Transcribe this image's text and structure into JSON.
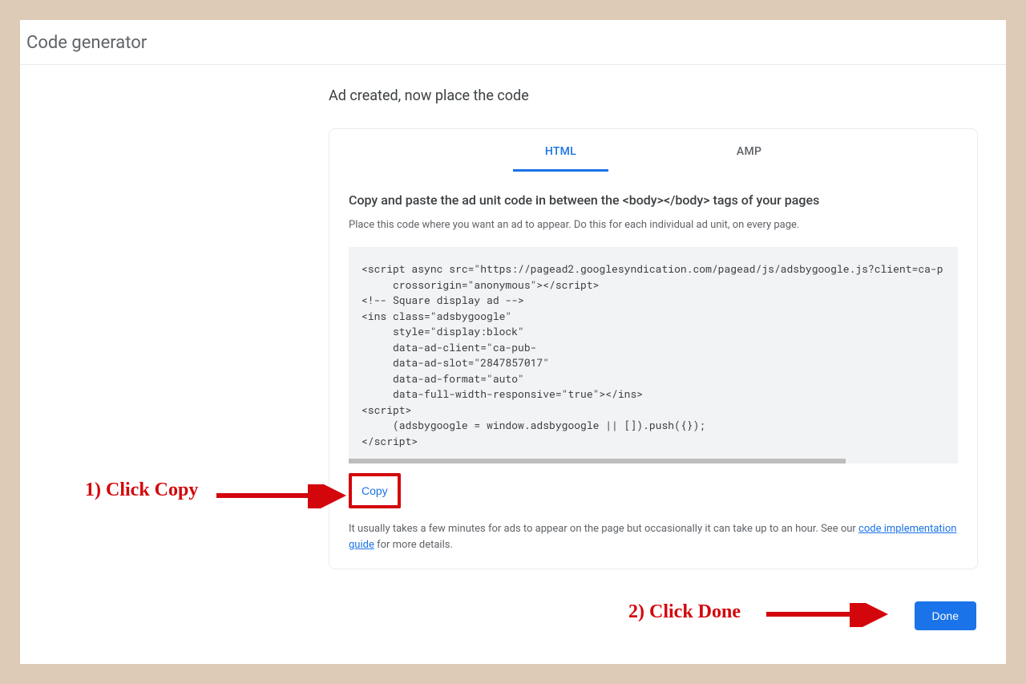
{
  "header": {
    "title": "Code generator"
  },
  "main": {
    "heading": "Ad created, now place the code",
    "tabs": {
      "html": "HTML",
      "amp": "AMP"
    },
    "instruction_title": "Copy and paste the ad unit code in between the <body></body> tags of your pages",
    "instruction_sub": "Place this code where you want an ad to appear. Do this for each individual ad unit, on every page.",
    "code": "<script async src=\"https://pagead2.googlesyndication.com/pagead/js/adsbygoogle.js?client=ca-p\n     crossorigin=\"anonymous\"></script>\n<!-- Square display ad -->\n<ins class=\"adsbygoogle\"\n     style=\"display:block\"\n     data-ad-client=\"ca-pub-\n     data-ad-slot=\"2847857017\"\n     data-ad-format=\"auto\"\n     data-full-width-responsive=\"true\"></ins>\n<script>\n     (adsbygoogle = window.adsbygoogle || []).push({});\n</script>",
    "copy_label": "Copy",
    "note_pre": "It usually takes a few minutes for ads to appear on the page but occasionally it can take up to an hour. See our ",
    "note_link": "code implementation guide",
    "note_post": " for more details."
  },
  "footer": {
    "done_label": "Done"
  },
  "annotations": {
    "step1": "1) Click Copy",
    "step2": "2) Click Done"
  }
}
